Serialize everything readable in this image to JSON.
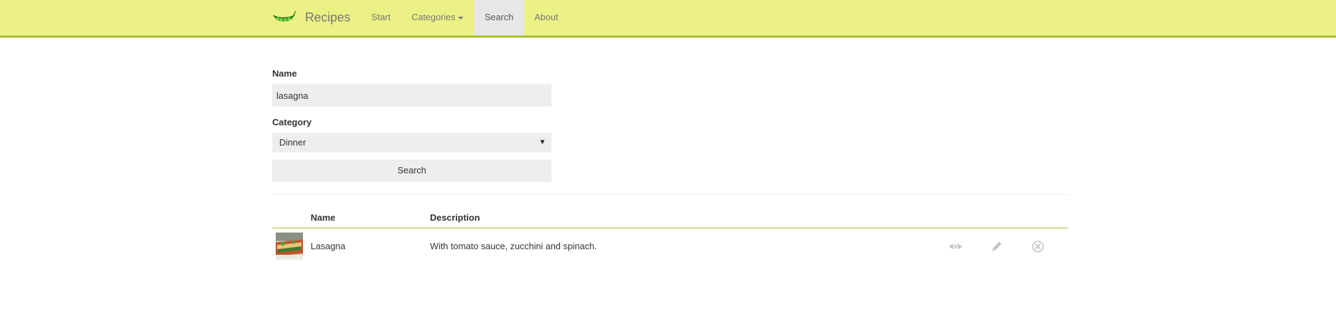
{
  "navbar": {
    "brand": "Recipes",
    "items": [
      {
        "label": "Start"
      },
      {
        "label": "Categories"
      },
      {
        "label": "Search"
      },
      {
        "label": "About"
      }
    ],
    "active_item": "Search"
  },
  "search_form": {
    "name_label": "Name",
    "name_value": "lasagna",
    "category_label": "Category",
    "category_selected": "Dinner",
    "submit_label": "Search"
  },
  "results": {
    "columns": [
      "",
      "Name",
      "Description",
      ""
    ],
    "rows": [
      {
        "name": "Lasagna",
        "description": "With tomato sauce, zucchini and spinach.",
        "thumbnail": "lasagna-photo",
        "actions": [
          "view-eye-icon",
          "edit-pencil-icon",
          "delete-x-circle-icon"
        ]
      }
    ]
  },
  "colors": {
    "navbar_bg": "#ecf185",
    "navbar_border": "#a6c12f",
    "active_nav_bg": "#e7e7e7",
    "input_bg": "#eeeeee",
    "table_header_border": "#a6c12f",
    "icon_gray": "#c4c4c4"
  }
}
